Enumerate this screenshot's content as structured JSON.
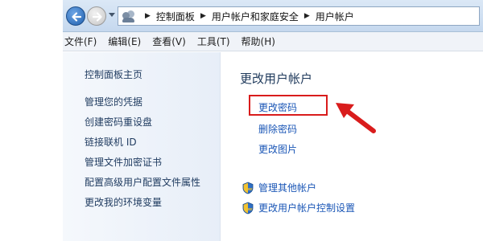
{
  "breadcrumb": [
    "控制面板",
    "用户帐户和家庭安全",
    "用户帐户"
  ],
  "menu": [
    "文件(F)",
    "编辑(E)",
    "查看(V)",
    "工具(T)",
    "帮助(H)"
  ],
  "sidebar": [
    {
      "label": "控制面板主页"
    },
    {
      "label": "管理您的凭据"
    },
    {
      "label": "创建密码重设盘"
    },
    {
      "label": "链接联机 ID"
    },
    {
      "label": "管理文件加密证书"
    },
    {
      "label": "配置高级用户配置文件属性"
    },
    {
      "label": "更改我的环境变量"
    }
  ],
  "main": {
    "title": "更改用户帐户",
    "tasks": [
      {
        "label": "更改密码",
        "highlighted": true
      },
      {
        "label": "删除密码"
      },
      {
        "label": "更改图片"
      }
    ],
    "admin_tasks": [
      {
        "label": "管理其他帐户",
        "icon": "uac-shield-icon"
      },
      {
        "label": "更改用户帐户控制设置",
        "icon": "uac-shield-icon"
      }
    ]
  },
  "colors": {
    "link": "#1a56b6",
    "highlight": "#d91c1c",
    "title": "#1e395b"
  }
}
